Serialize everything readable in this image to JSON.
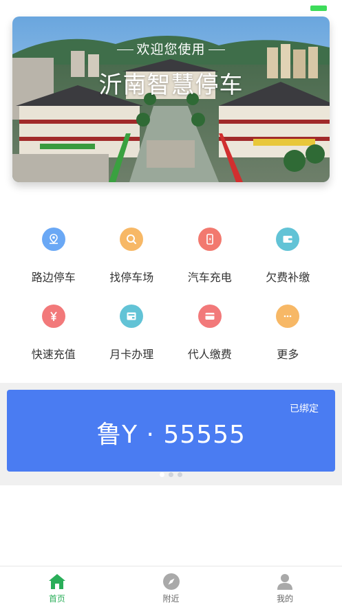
{
  "banner": {
    "welcome": "欢迎您使用",
    "title": "沂南智慧停车"
  },
  "menu": [
    {
      "label": "路边停车",
      "icon": "map-pin-icon",
      "color": "#6aa8f5"
    },
    {
      "label": "找停车场",
      "icon": "search-icon",
      "color": "#f7b866"
    },
    {
      "label": "汽车充电",
      "icon": "charging-icon",
      "color": "#f2796f"
    },
    {
      "label": "欠费补缴",
      "icon": "wallet-icon",
      "color": "#62c3d6"
    },
    {
      "label": "快速充值",
      "icon": "yuan-icon",
      "color": "#f2797a"
    },
    {
      "label": "月卡办理",
      "icon": "card-icon",
      "color": "#62c3d6"
    },
    {
      "label": "代人缴费",
      "icon": "payment-card-icon",
      "color": "#f2797a"
    },
    {
      "label": "更多",
      "icon": "more-icon",
      "color": "#f7b866"
    }
  ],
  "plate_card": {
    "status": "已绑定",
    "plate": "鲁Y · 55555",
    "pages": 3,
    "current_page": 1
  },
  "tabbar": [
    {
      "label": "首页",
      "icon": "home-icon",
      "active": true
    },
    {
      "label": "附近",
      "icon": "compass-icon",
      "active": false
    },
    {
      "label": "我的",
      "icon": "user-icon",
      "active": false
    }
  ],
  "colors": {
    "accent_green": "#2aae59",
    "plate_blue": "#4a7cf2"
  }
}
